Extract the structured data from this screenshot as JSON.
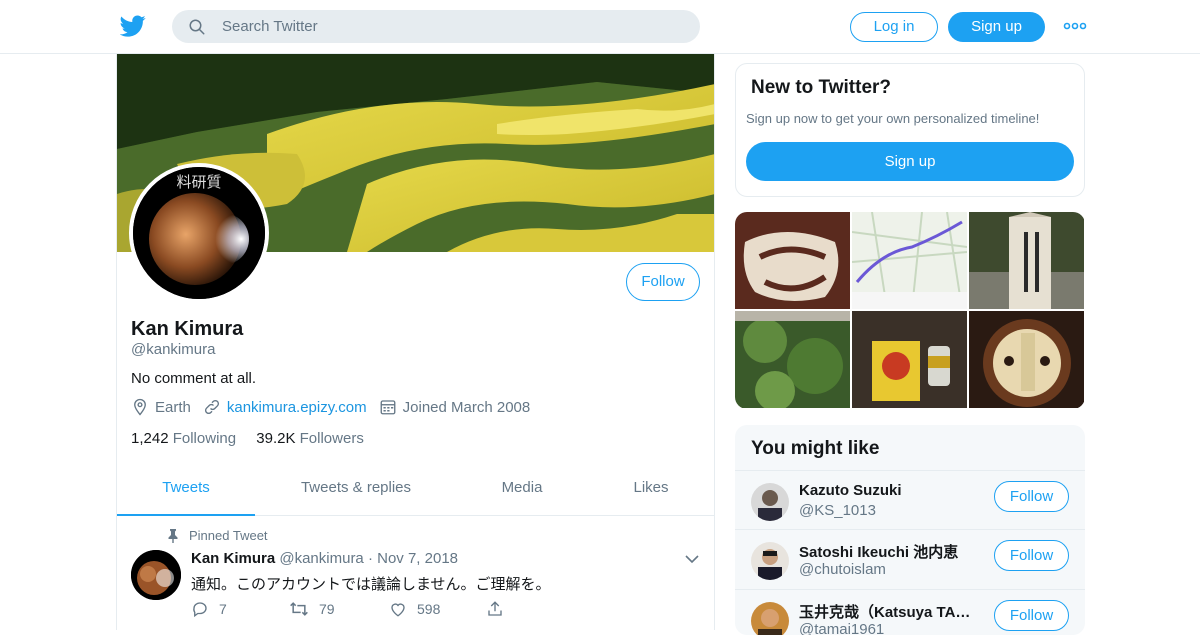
{
  "header": {
    "search_placeholder": "Search Twitter",
    "login_label": "Log in",
    "signup_label": "Sign up",
    "more_icon": "more-dots-icon"
  },
  "profile": {
    "name": "Kan Kimura",
    "handle": "@kankimura",
    "bio": "No comment at all.",
    "location": "Earth",
    "website": "kankimura.epizy.com",
    "joined": "Joined March 2008",
    "following_count": "1,242",
    "following_label": "Following",
    "followers_count": "39.2K",
    "followers_label": "Followers",
    "follow_label": "Follow",
    "avatar_caption": "料研質"
  },
  "tabs": [
    {
      "label": "Tweets",
      "active": true
    },
    {
      "label": "Tweets & replies",
      "active": false
    },
    {
      "label": "Media",
      "active": false
    },
    {
      "label": "Likes",
      "active": false
    }
  ],
  "pinned_tweet": {
    "pinned_label": "Pinned Tweet",
    "author": "Kan Kimura",
    "handle": "@kankimura",
    "separator": "·",
    "date": "Nov 7, 2018",
    "text": "通知。このアカウントでは議論しません。ご理解を。",
    "replies": "7",
    "retweets": "79",
    "likes": "598"
  },
  "sidebar": {
    "new_title": "New to Twitter?",
    "new_text": "Sign up now to get your own personalized timeline!",
    "signup_label": "Sign up",
    "you_might_like_title": "You might like",
    "suggestions": [
      {
        "name": "Kazuto Suzuki",
        "handle": "@KS_1013",
        "follow": "Follow"
      },
      {
        "name": "Satoshi Ikeuchi 池内恵",
        "handle": "@chutoislam",
        "follow": "Follow"
      },
      {
        "name": "玉井克哉（Katsuya TAMAI）",
        "handle": "@tamai1961",
        "follow": "Follow"
      }
    ]
  },
  "colors": {
    "accent": "#1da1f2",
    "secondary_text": "#657786",
    "border": "#e6ecf0"
  }
}
